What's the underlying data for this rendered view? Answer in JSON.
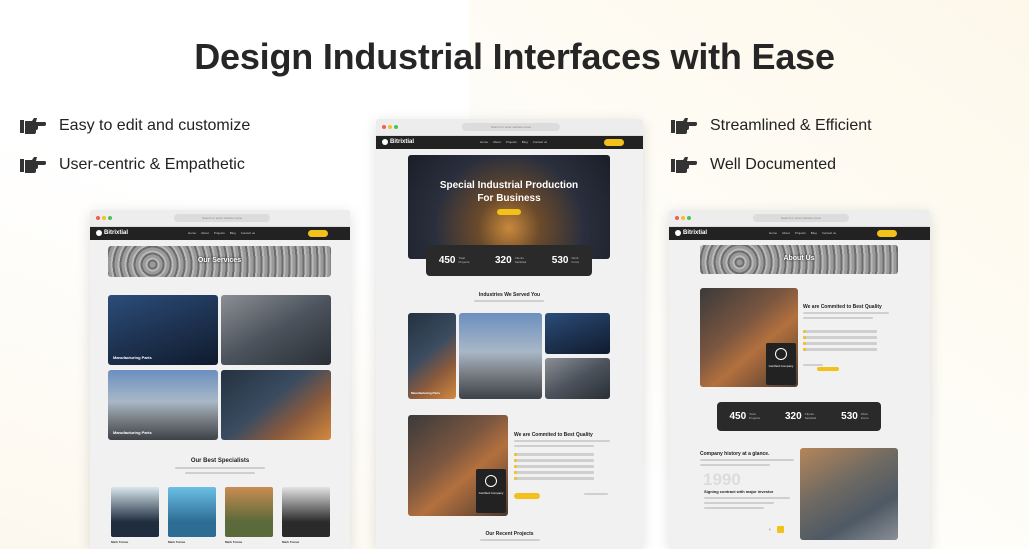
{
  "headline": "Design Industrial Interfaces with Ease",
  "features": [
    {
      "icon": "pointing-hand-icon",
      "label": "Easy to edit and customize"
    },
    {
      "icon": "pointing-hand-icon",
      "label": "User-centric & Empathetic"
    },
    {
      "icon": "pointing-hand-icon",
      "label": "Streamlined & Efficient"
    },
    {
      "icon": "pointing-hand-icon",
      "label": "Well Documented"
    }
  ],
  "mock_brand": "Bitrixtial",
  "mock_url": "Search or enter website name",
  "nav_links": [
    "Home",
    "About",
    "Projects",
    "Blog",
    "Contact us"
  ],
  "left": {
    "banner": "Our Services",
    "card1": "Manufacturing Parts",
    "card3": "Manufacturing Parts",
    "specialists_title": "Our Best Specialists",
    "specialist_names": [
      "Mark Tomas",
      "Mark Tomas",
      "Mark Tomas",
      "Mark Tomas"
    ]
  },
  "center": {
    "hero_title_1": "Special Industrial Production",
    "hero_title_2": "For Business",
    "stats": [
      {
        "num": "450",
        "label1": "Total",
        "label2": "Projects"
      },
      {
        "num": "320",
        "label1": "Clients",
        "label2": "Satisfied"
      },
      {
        "num": "530",
        "label1": "Work",
        "label2": "Force"
      }
    ],
    "industries_title": "Industries We Served You",
    "card_label": "Manufacturing Parts",
    "quality_title": "We are Commited to Best Quality",
    "badge": "Certified Company",
    "recent_title": "Our Recent Projects"
  },
  "right": {
    "banner": "About Us",
    "quality_title": "We are Commited to Best Quality",
    "badge": "Certified Company",
    "stats": [
      {
        "num": "450",
        "label1": "Total",
        "label2": "Projects"
      },
      {
        "num": "320",
        "label1": "Clients",
        "label2": "Satisfied"
      },
      {
        "num": "530",
        "label1": "Work",
        "label2": "Force"
      }
    ],
    "history_title": "Company history at a glance.",
    "history_year": "1990",
    "history_sub": "Signing contract with major investor"
  },
  "colors": {
    "accent": "#f2c21b",
    "dark": "#222222",
    "headline": "#262626"
  }
}
